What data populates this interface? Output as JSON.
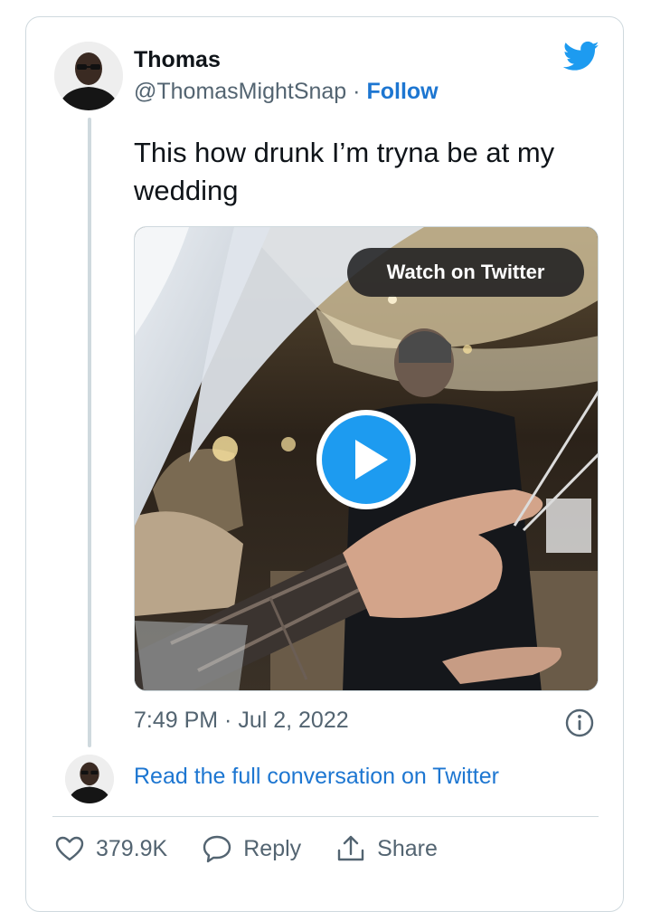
{
  "tweet": {
    "display_name": "Thomas",
    "handle": "@ThomasMightSnap",
    "separator": "·",
    "follow_label": "Follow",
    "text": "This how drunk I’m tryna be at my wedding",
    "timestamp": "7:49 PM · Jul 2, 2022"
  },
  "media": {
    "watch_label": "Watch on Twitter"
  },
  "conversation": {
    "link_text": "Read the full conversation on Twitter"
  },
  "actions": {
    "likes": "379.9K",
    "reply_label": "Reply",
    "share_label": "Share"
  },
  "icons": {
    "brand": "twitter-bird-icon",
    "play": "play-icon",
    "info": "info-icon",
    "like": "heart-icon",
    "reply": "reply-icon",
    "share": "share-icon"
  },
  "colors": {
    "link": "#1d76d1",
    "twitter_blue": "#1d9bf0",
    "muted": "#536471",
    "border": "#cfd9de"
  }
}
